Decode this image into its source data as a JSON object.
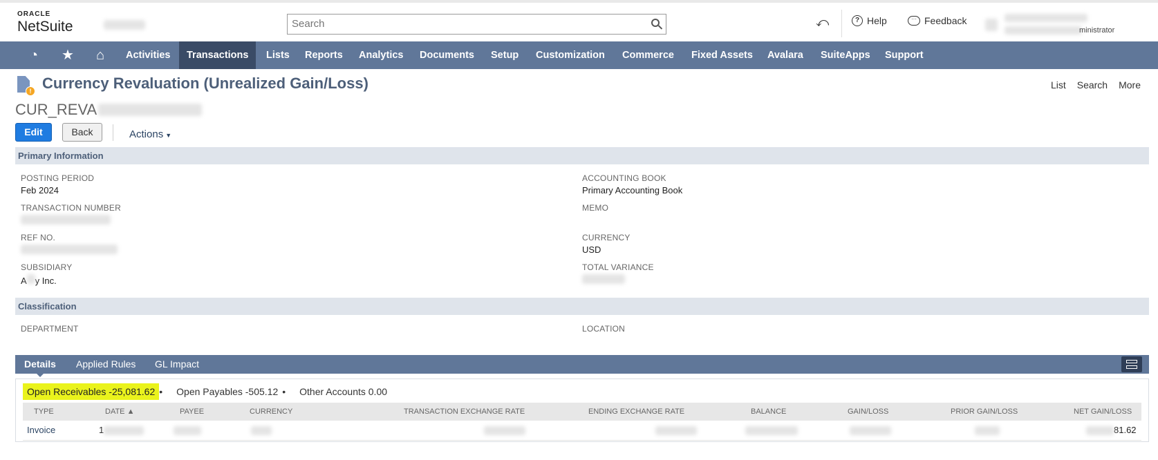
{
  "header": {
    "logo_top": "ORACLE",
    "logo_bottom": "NetSuite",
    "search_placeholder": "Search",
    "help_label": "Help",
    "feedback_label": "Feedback",
    "user_role_suffix": "ministrator"
  },
  "nav": {
    "icons": [
      "recent-icon",
      "star-icon",
      "home-icon"
    ],
    "items": [
      "Activities",
      "Transactions",
      "Lists",
      "Reports",
      "Analytics",
      "Documents",
      "Setup",
      "Customization",
      "Commerce",
      "Fixed Assets",
      "Avalara",
      "SuiteApps",
      "Support"
    ],
    "active": "Transactions",
    "active_color": "#3a4b66",
    "bar_color": "#607799"
  },
  "page": {
    "title": "Currency Revaluation (Unrealized Gain/Loss)",
    "record_prefix": "CUR_REVA",
    "links": [
      "List",
      "Search",
      "More"
    ],
    "edit_label": "Edit",
    "back_label": "Back",
    "actions_label": "Actions"
  },
  "primary": {
    "heading": "Primary Information",
    "posting_period_label": "POSTING PERIOD",
    "posting_period_value": "Feb 2024",
    "transaction_number_label": "TRANSACTION NUMBER",
    "ref_no_label": "REF NO.",
    "subsidiary_label": "SUBSIDIARY",
    "subsidiary_prefix": "A",
    "subsidiary_suffix": "y Inc.",
    "accounting_book_label": "ACCOUNTING BOOK",
    "accounting_book_value": "Primary Accounting Book",
    "memo_label": "MEMO",
    "currency_label": "CURRENCY",
    "currency_value": "USD",
    "total_variance_label": "TOTAL VARIANCE"
  },
  "classification": {
    "heading": "Classification",
    "department_label": "DEPARTMENT",
    "location_label": "LOCATION"
  },
  "tabs": {
    "details": "Details",
    "applied_rules": "Applied Rules",
    "gl_impact": "GL Impact"
  },
  "subtabs": {
    "open_receivables": "Open Receivables -25,081.62",
    "open_payables": "Open Payables -505.12",
    "other_accounts": "Other Accounts 0.00",
    "highlight_color": "#eaf31c"
  },
  "grid": {
    "columns": [
      "TYPE",
      "DATE ▲",
      "PAYEE",
      "CURRENCY",
      "TRANSACTION EXCHANGE RATE",
      "ENDING EXCHANGE RATE",
      "BALANCE",
      "GAIN/LOSS",
      "PRIOR GAIN/LOSS",
      "NET GAIN/LOSS"
    ],
    "row": {
      "type": "Invoice",
      "date_prefix": "1",
      "net_gain_loss_suffix": "81.62"
    }
  }
}
